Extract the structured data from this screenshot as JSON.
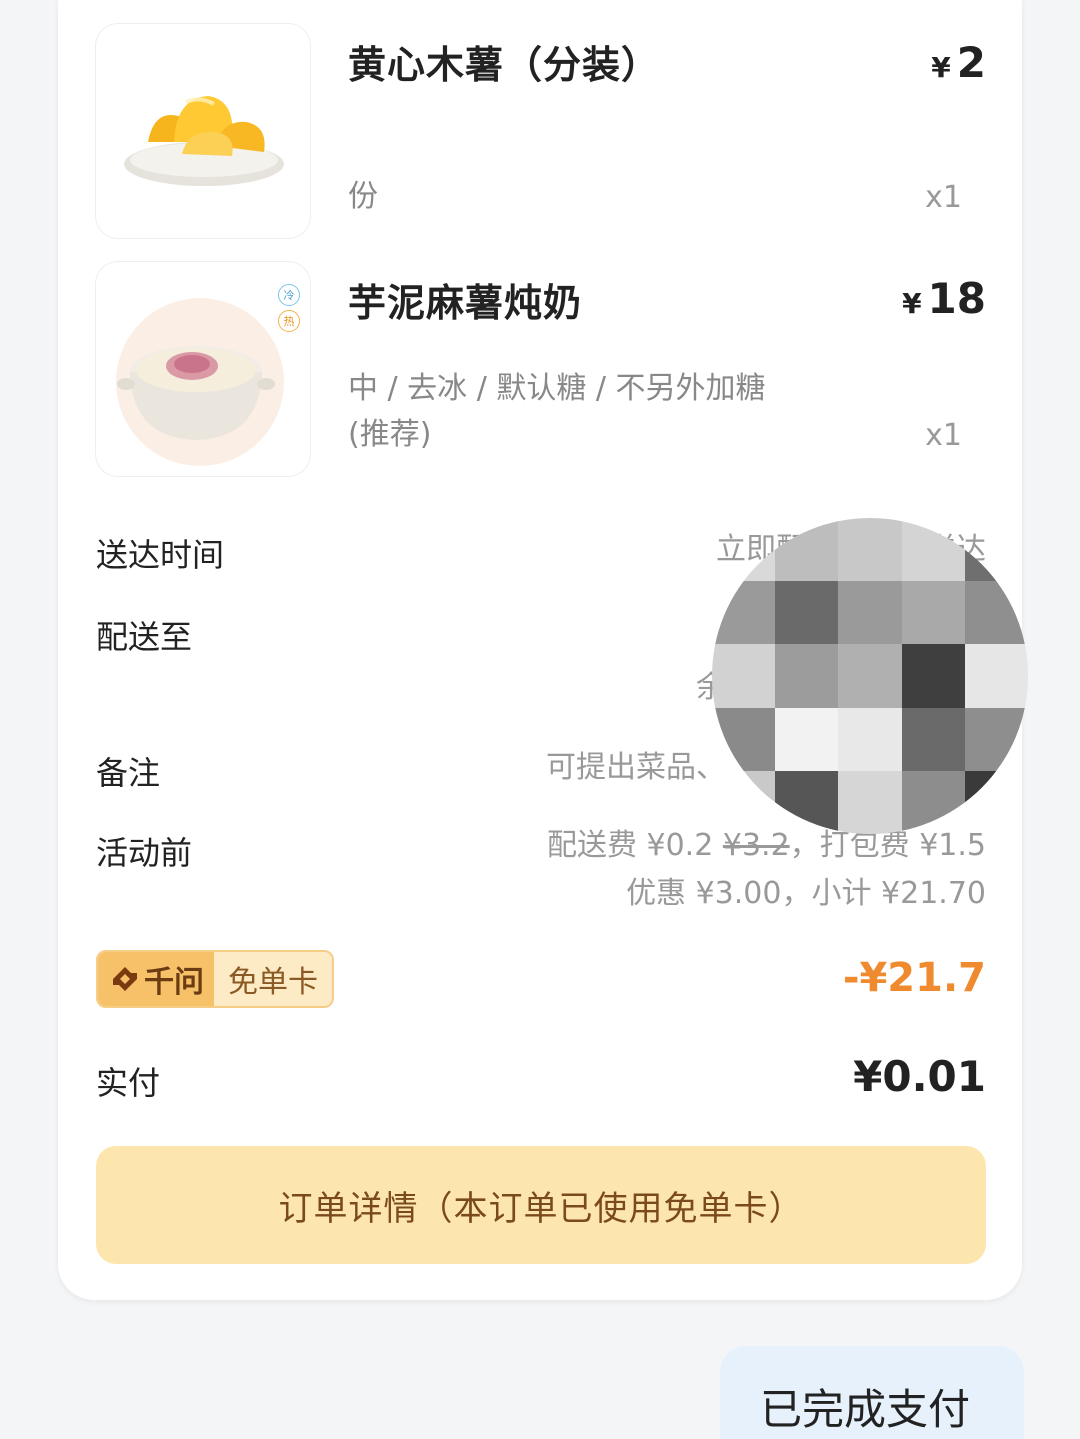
{
  "items": [
    {
      "name": "黄心木薯（分装）",
      "price_symbol": "¥",
      "price": "2",
      "spec": "份",
      "qty": "x1"
    },
    {
      "name": "芋泥麻薯炖奶",
      "price_symbol": "¥",
      "price": "18",
      "spec_line1": "中 / 去冰 / 默认糖 / 不另外加糖",
      "spec_line2": "(推荐)",
      "qty": "x1",
      "tags": [
        "冷",
        "热"
      ]
    }
  ],
  "rows": {
    "delivery_time": {
      "label": "送达时间",
      "value": "立即配送，预计送达"
    },
    "deliver_to": {
      "label": "配送至",
      "value": "余"
    },
    "remark": {
      "label": "备注",
      "value": "可提出菜品、"
    },
    "before_promo": {
      "label": "活动前",
      "fee_prefix": "配送费 ¥0.2",
      "fee_original": "¥3.2",
      "fee_suffix": "，打包费 ¥1.5",
      "line2": "优惠 ¥3.00，小计 ¥21.70"
    }
  },
  "badge": {
    "brand": "千问",
    "card": "免单卡"
  },
  "discount": "-¥21.7",
  "paid": {
    "label": "实付",
    "value": "¥0.01"
  },
  "detail_button": "订单详情（本订单已使用免单卡）",
  "chat_bubble": "已完成支付",
  "colors": {
    "accent_orange": "#f08a2e",
    "button_bg": "#fde6ad",
    "badge_bg": "#f7c16a"
  }
}
